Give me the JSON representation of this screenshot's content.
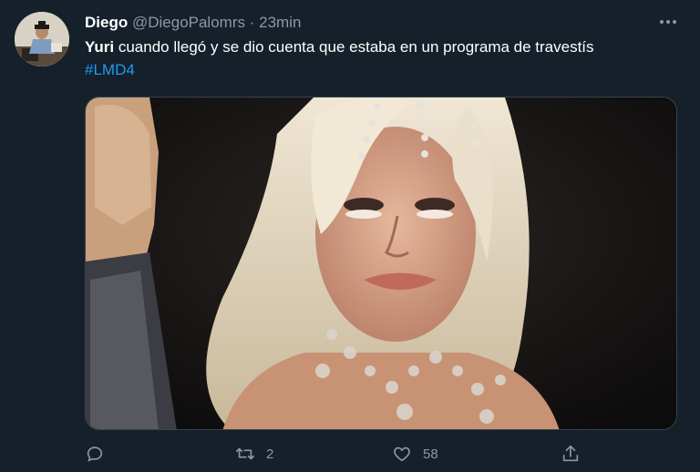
{
  "tweet": {
    "author_name": "Diego",
    "author_handle": "@DiegoPalomrs",
    "separator": "·",
    "time": "23min",
    "text_bold": "Yuri",
    "text_rest": " cuando llegó y se dio cuenta que estaba en un programa de travestís",
    "hashtag": "#LMD4"
  },
  "actions": {
    "reply": {
      "icon": "reply-icon",
      "count": ""
    },
    "retweet": {
      "icon": "retweet-icon",
      "count": "2"
    },
    "like": {
      "icon": "heart-icon",
      "count": "58"
    },
    "share": {
      "icon": "share-icon",
      "count": ""
    }
  },
  "colors": {
    "background": "#15202b",
    "text": "#ffffff",
    "secondary": "#8b98a5",
    "link": "#1d9bf0",
    "border": "#38444d"
  }
}
